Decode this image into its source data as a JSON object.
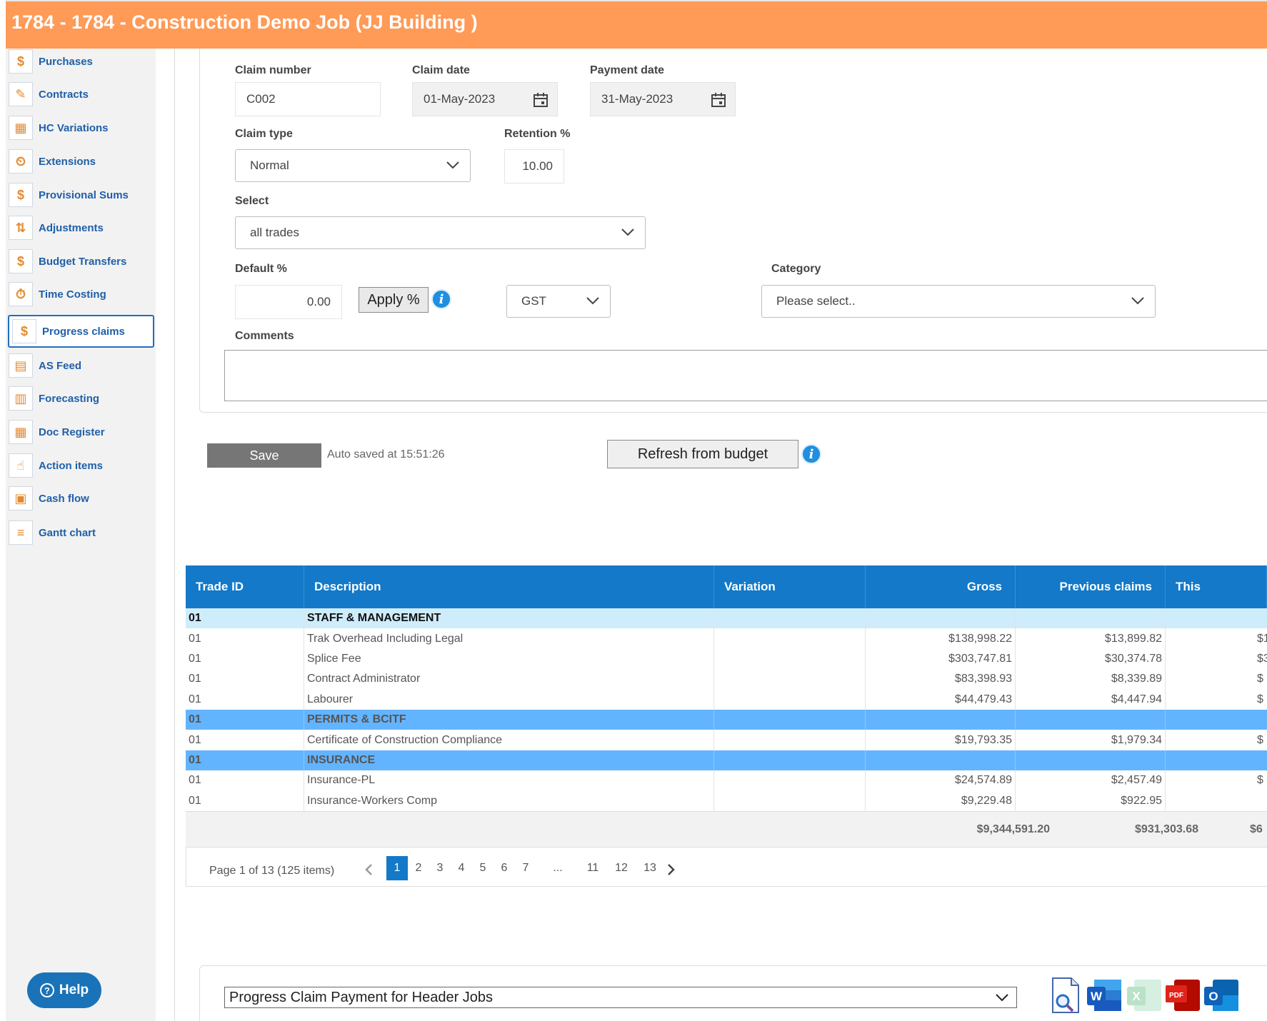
{
  "header": {
    "title": "1784 - 1784 - Construction Demo Job (JJ Building )"
  },
  "sidebar": {
    "items": [
      {
        "label": "Purchases",
        "icon": "purchases-icon"
      },
      {
        "label": "Contracts",
        "icon": "contracts-icon"
      },
      {
        "label": "HC Variations",
        "icon": "hc-variations-icon"
      },
      {
        "label": "Extensions",
        "icon": "extensions-icon"
      },
      {
        "label": "Provisional Sums",
        "icon": "provisional-sums-icon"
      },
      {
        "label": "Adjustments",
        "icon": "adjustments-icon"
      },
      {
        "label": "Budget Transfers",
        "icon": "budget-transfers-icon"
      },
      {
        "label": "Time Costing",
        "icon": "time-costing-icon"
      },
      {
        "label": "Progress claims",
        "icon": "progress-claims-icon",
        "active": true
      },
      {
        "label": "AS Feed",
        "icon": "as-feed-icon"
      },
      {
        "label": "Forecasting",
        "icon": "forecasting-icon"
      },
      {
        "label": "Doc Register",
        "icon": "doc-register-icon"
      },
      {
        "label": "Action items",
        "icon": "action-items-icon"
      },
      {
        "label": "Cash flow",
        "icon": "cash-flow-icon"
      },
      {
        "label": "Gantt chart",
        "icon": "gantt-chart-icon"
      }
    ],
    "help_label": "Help"
  },
  "form": {
    "claim_number_label": "Claim number",
    "claim_number_value": "C002",
    "claim_date_label": "Claim date",
    "claim_date_value": "01-May-2023",
    "payment_date_label": "Payment date",
    "payment_date_value": "31-May-2023",
    "claim_type_label": "Claim type",
    "claim_type_value": "Normal",
    "retention_label": "Retention %",
    "retention_value": "10.00",
    "select_label": "Select",
    "select_value": "all trades",
    "default_pct_label": "Default %",
    "default_pct_value": "0.00",
    "apply_label": "Apply %",
    "gst_value": "GST",
    "category_label": "Category",
    "category_placeholder": "Please select..",
    "comments_label": "Comments",
    "comments_value": ""
  },
  "actions": {
    "save_label": "Save",
    "auto_saved": "Auto saved at 15:51:26",
    "refresh_label": "Refresh from budget"
  },
  "grid": {
    "columns": [
      "Trade ID",
      "Description",
      "Variation",
      "Gross",
      "Previous claims",
      "This"
    ],
    "rows": [
      {
        "kind": "group1",
        "trade": "01",
        "desc": "STAFF & MANAGEMENT",
        "variation": "",
        "gross": "",
        "prev": "",
        "this": ""
      },
      {
        "kind": "item",
        "trade": "01",
        "desc": "Trak Overhead Including Legal",
        "variation": "",
        "gross": "$138,998.22",
        "prev": "$13,899.82",
        "this": "$1"
      },
      {
        "kind": "item",
        "trade": "01",
        "desc": "Splice Fee",
        "variation": "",
        "gross": "$303,747.81",
        "prev": "$30,374.78",
        "this": "$3"
      },
      {
        "kind": "item",
        "trade": "01",
        "desc": "Contract Administrator",
        "variation": "",
        "gross": "$83,398.93",
        "prev": "$8,339.89",
        "this": "$"
      },
      {
        "kind": "item",
        "trade": "01",
        "desc": "Labourer",
        "variation": "",
        "gross": "$44,479.43",
        "prev": "$4,447.94",
        "this": "$"
      },
      {
        "kind": "group2",
        "trade": "01",
        "desc": "PERMITS & BCITF",
        "variation": "",
        "gross": "",
        "prev": "",
        "this": ""
      },
      {
        "kind": "item",
        "trade": "01",
        "desc": "Certificate of Construction Compliance",
        "variation": "",
        "gross": "$19,793.35",
        "prev": "$1,979.34",
        "this": "$"
      },
      {
        "kind": "group2",
        "trade": "01",
        "desc": "INSURANCE",
        "variation": "",
        "gross": "",
        "prev": "",
        "this": ""
      },
      {
        "kind": "item",
        "trade": "01",
        "desc": "Insurance-PL",
        "variation": "",
        "gross": "$24,574.89",
        "prev": "$2,457.49",
        "this": "$"
      },
      {
        "kind": "item",
        "trade": "01",
        "desc": "Insurance-Workers Comp",
        "variation": "",
        "gross": "$9,229.48",
        "prev": "$922.95",
        "this": ""
      }
    ],
    "totals": {
      "gross": "$9,344,591.20",
      "prev": "$931,303.68",
      "this": "$6"
    },
    "pager": {
      "info": "Page 1 of 13 (125 items)",
      "pages": [
        "1",
        "2",
        "3",
        "4",
        "5",
        "6",
        "7",
        "...",
        "11",
        "12",
        "13"
      ],
      "current": "1"
    }
  },
  "report": {
    "selected": "Progress Claim Payment for Header Jobs",
    "export_icons": [
      "preview-icon",
      "word-icon",
      "excel-icon",
      "pdf-icon",
      "outlook-icon"
    ]
  },
  "colors": {
    "header": "#ff9a57",
    "accent": "#1379c8",
    "group_light": "#cfecfb",
    "group_mid": "#63b4ff",
    "link": "#1f5fa8"
  }
}
